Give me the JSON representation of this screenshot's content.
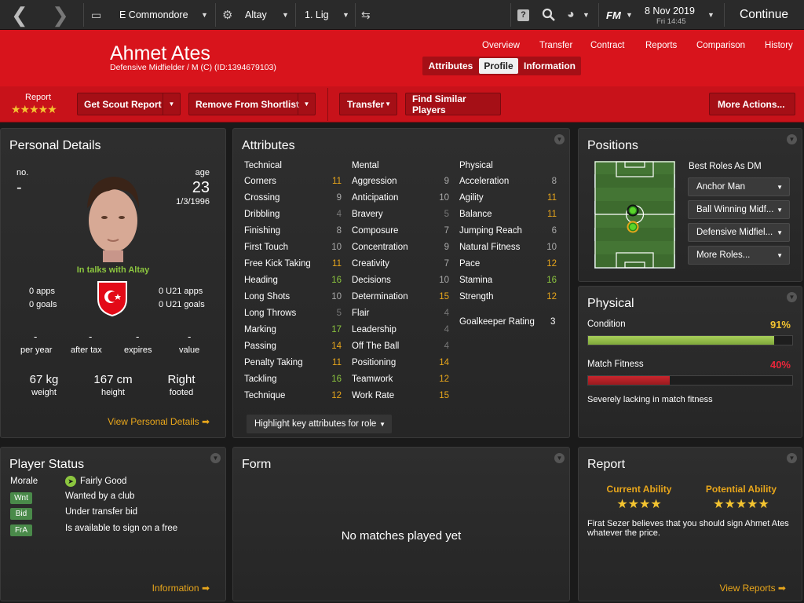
{
  "topbar": {
    "club": "E Commondore",
    "team": "Altay",
    "league": "1. Lig",
    "date": "8 Nov 2019",
    "time": "Fri 14:45",
    "continue": "Continue",
    "fm": "FM"
  },
  "player": {
    "name": "Ahmet Ates",
    "subtitle": "Defensive Midfielder / M (C) (ID:1394679103)"
  },
  "nav": {
    "links": [
      "Overview",
      "Transfer",
      "Contract",
      "Reports",
      "Comparison",
      "History"
    ],
    "tabs": [
      "Attributes",
      "Profile",
      "Information"
    ]
  },
  "actions": {
    "report_label": "Report",
    "report_stars": "★★★★★",
    "scout": "Get Scout Report",
    "shortlist": "Remove From Shortlist",
    "transfer": "Transfer",
    "similar": "Find Similar Players",
    "more": "More Actions..."
  },
  "personal": {
    "title": "Personal Details",
    "no_label": "no.",
    "no_value": "-",
    "age_label": "age",
    "age_value": "23",
    "dob": "1/3/1996",
    "status": "In talks with Altay",
    "apps": "0 apps",
    "goals": "0 goals",
    "u21apps": "0 U21 apps",
    "u21goals": "0 U21 goals",
    "per_year_v": "-",
    "after_tax_v": "-",
    "expires_v": "-",
    "value_v": "-",
    "per_year": "per year",
    "after_tax": "after tax",
    "expires": "expires",
    "value": "value",
    "weight_v": "67 kg",
    "weight": "weight",
    "height_v": "167 cm",
    "height": "height",
    "foot_v": "Right",
    "foot": "footed",
    "link": "View Personal Details ➡"
  },
  "attributes": {
    "title": "Attributes",
    "technical_h": "Technical",
    "mental_h": "Mental",
    "physical_h": "Physical",
    "highlight": "Highlight key attributes for role",
    "technical": [
      [
        "Corners",
        "11",
        "#e8a61b"
      ],
      [
        "Crossing",
        "9",
        "#aaa"
      ],
      [
        "Dribbling",
        "4",
        "#777"
      ],
      [
        "Finishing",
        "8",
        "#aaa"
      ],
      [
        "First Touch",
        "10",
        "#aaa"
      ],
      [
        "Free Kick Taking",
        "11",
        "#e8a61b"
      ],
      [
        "Heading",
        "16",
        "#8cc63f"
      ],
      [
        "Long Shots",
        "10",
        "#aaa"
      ],
      [
        "Long Throws",
        "5",
        "#777"
      ],
      [
        "Marking",
        "17",
        "#8cc63f"
      ],
      [
        "Passing",
        "14",
        "#e8a61b"
      ],
      [
        "Penalty Taking",
        "11",
        "#e8a61b"
      ],
      [
        "Tackling",
        "16",
        "#8cc63f"
      ],
      [
        "Technique",
        "12",
        "#e8a61b"
      ]
    ],
    "mental": [
      [
        "Aggression",
        "9",
        "#aaa"
      ],
      [
        "Anticipation",
        "10",
        "#aaa"
      ],
      [
        "Bravery",
        "5",
        "#777"
      ],
      [
        "Composure",
        "7",
        "#aaa"
      ],
      [
        "Concentration",
        "9",
        "#aaa"
      ],
      [
        "Creativity",
        "7",
        "#aaa"
      ],
      [
        "Decisions",
        "10",
        "#aaa"
      ],
      [
        "Determination",
        "15",
        "#e8a61b"
      ],
      [
        "Flair",
        "4",
        "#777"
      ],
      [
        "Leadership",
        "4",
        "#777"
      ],
      [
        "Off The Ball",
        "4",
        "#777"
      ],
      [
        "Positioning",
        "14",
        "#e8a61b"
      ],
      [
        "Teamwork",
        "12",
        "#e8a61b"
      ],
      [
        "Work Rate",
        "15",
        "#e8a61b"
      ]
    ],
    "physical": [
      [
        "Acceleration",
        "8",
        "#aaa"
      ],
      [
        "Agility",
        "11",
        "#e8a61b"
      ],
      [
        "Balance",
        "11",
        "#e8a61b"
      ],
      [
        "Jumping Reach",
        "6",
        "#aaa"
      ],
      [
        "Natural Fitness",
        "10",
        "#aaa"
      ],
      [
        "Pace",
        "12",
        "#e8a61b"
      ],
      [
        "Stamina",
        "16",
        "#8cc63f"
      ],
      [
        "Strength",
        "12",
        "#e8a61b"
      ]
    ],
    "gk_label": "Goalkeeper Rating",
    "gk_value": "3"
  },
  "positions": {
    "title": "Positions",
    "best_roles": "Best Roles As DM",
    "roles": [
      "Anchor Man",
      "Ball Winning Midf...",
      "Defensive Midfiel...",
      "More Roles..."
    ]
  },
  "physical": {
    "title": "Physical",
    "condition_label": "Condition",
    "condition_value": "91%",
    "condition_fraction": 0.91,
    "fitness_label": "Match Fitness",
    "fitness_value": "40%",
    "fitness_fraction": 0.4,
    "note": "Severely lacking in match fitness"
  },
  "status": {
    "title": "Player Status",
    "morale_label": "Morale",
    "morale_value": "Fairly Good",
    "items": [
      [
        "Wnt",
        "Wanted by a club"
      ],
      [
        "Bid",
        "Under transfer bid"
      ],
      [
        "FrA",
        "Is available to sign on a free"
      ]
    ],
    "link": "Information ➡"
  },
  "form": {
    "title": "Form",
    "empty": "No matches played yet"
  },
  "report": {
    "title": "Report",
    "current": "Current Ability",
    "current_stars": "★★★★",
    "potential": "Potential Ability",
    "potential_stars": "★★★★★",
    "text": "Firat Sezer believes that you should sign Ahmet Ates whatever the price.",
    "link": "View Reports ➡"
  }
}
